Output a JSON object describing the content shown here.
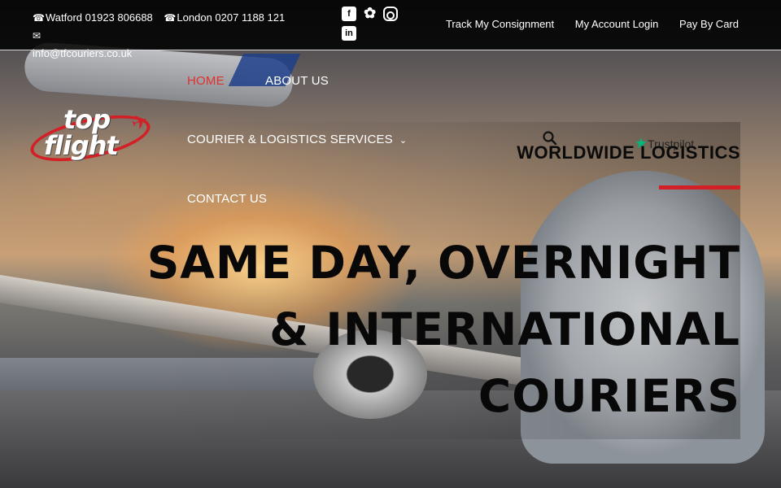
{
  "topbar": {
    "contacts": [
      {
        "icon": "phone-icon",
        "text": "Watford 01923 806688"
      },
      {
        "icon": "phone-icon",
        "text": "London 0207 1188 121"
      },
      {
        "icon": "envelope-icon",
        "text": "info@tfcouriers.co.uk"
      }
    ],
    "socials": [
      "facebook-icon",
      "twitter-icon",
      "instagram-icon",
      "linkedin-icon"
    ],
    "links": [
      "Track My Consignment",
      "My Account Login",
      "Pay By Card"
    ]
  },
  "logo": {
    "line1": "top",
    "line2": "flight"
  },
  "nav": {
    "home": "HOME",
    "about": "ABOUT US",
    "services": "COURIER & LOGISTICS SERVICES",
    "contact": "CONTACT US"
  },
  "colors": {
    "accent": "#d32027",
    "active_nav": "#e0312f",
    "trustpilot_star": "#00b67a"
  },
  "hero": {
    "trustpilot": "Trustpilot",
    "subtitle": "WORLDWIDE LOGISTICS",
    "headline": [
      "SAME DAY, OVERNIGHT",
      "& INTERNATIONAL",
      "COURIERS"
    ]
  }
}
